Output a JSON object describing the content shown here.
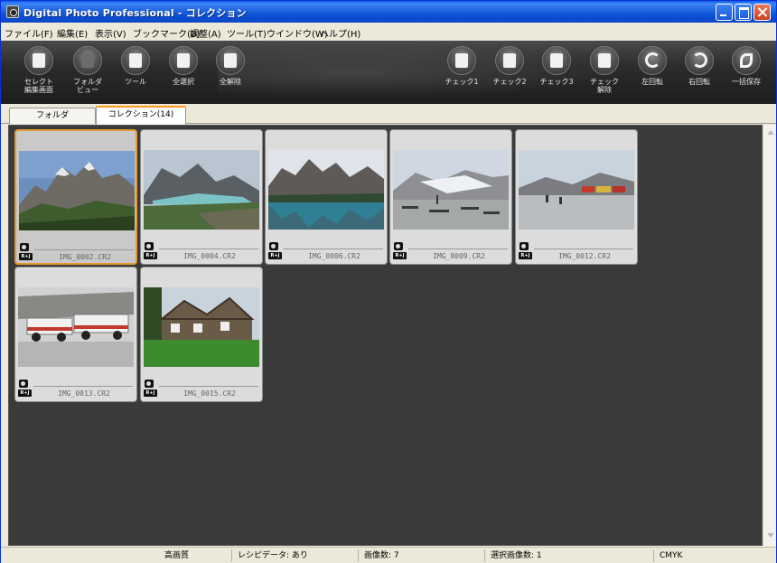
{
  "window": {
    "title": "Digital Photo Professional - コレクション"
  },
  "menu": [
    "ファイル(F)",
    "編集(E)",
    "表示(V)",
    "ブックマーク(B)",
    "調整(A)",
    "ツール(T)",
    "ウインドウ(W)",
    "ヘルプ(H)"
  ],
  "toolbar": {
    "left": [
      {
        "label": "セレクト\n編集画面",
        "icon": "select-edit-icon"
      },
      {
        "label": "フォルダ\nビュー",
        "icon": "folder-view-icon"
      },
      {
        "label": "ツール",
        "icon": "tool-icon"
      },
      {
        "label": "全選択",
        "icon": "select-all-icon"
      },
      {
        "label": "全解除",
        "icon": "deselect-all-icon"
      }
    ],
    "right": [
      {
        "label": "チェック1",
        "icon": "check1-icon"
      },
      {
        "label": "チェック2",
        "icon": "check2-icon"
      },
      {
        "label": "チェック3",
        "icon": "check3-icon"
      },
      {
        "label": "チェック\n解除",
        "icon": "check-clear-icon"
      },
      {
        "label": "左回転",
        "icon": "rotate-left-icon"
      },
      {
        "label": "右回転",
        "icon": "rotate-right-icon"
      },
      {
        "label": "一括保存",
        "icon": "batch-save-icon"
      }
    ]
  },
  "tabs": {
    "folder": "フォルダ",
    "collection": "コレクション(14)"
  },
  "thumbnails": [
    {
      "name": "IMG_0002.CR2",
      "badge": "R+J",
      "selected": true,
      "scene": "mountain"
    },
    {
      "name": "IMG_0004.CR2",
      "badge": "R+J",
      "selected": false,
      "scene": "lake"
    },
    {
      "name": "IMG_0006.CR2",
      "badge": "R+J",
      "selected": false,
      "scene": "reflection"
    },
    {
      "name": "IMG_0009.CR2",
      "badge": "R+J",
      "selected": false,
      "scene": "glacier-viewpoint"
    },
    {
      "name": "IMG_0012.CR2",
      "badge": "R+J",
      "selected": false,
      "scene": "glacier-buses"
    },
    {
      "name": "IMG_0013.CR2",
      "badge": "R+J",
      "selected": false,
      "scene": "snow-coaches"
    },
    {
      "name": "IMG_0015.CR2",
      "badge": "R+J",
      "selected": false,
      "scene": "lodge"
    }
  ],
  "status": {
    "quality": "高画質",
    "recipe": "レシピデータ: あり",
    "image_count": "画像数: 7",
    "selected_count": "選択画像数: 1",
    "color_mode": "CMYK"
  }
}
